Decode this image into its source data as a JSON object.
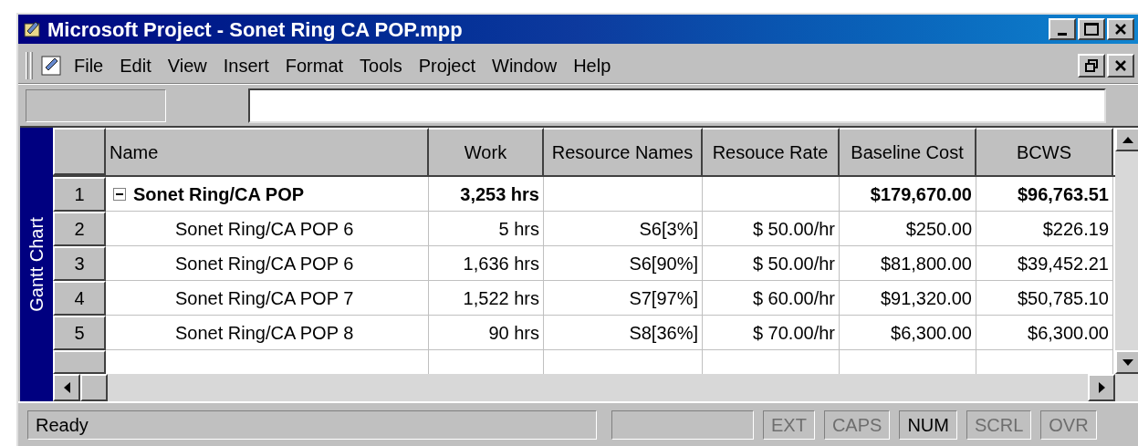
{
  "window": {
    "title": "Microsoft Project - Sonet Ring CA POP.mpp"
  },
  "menu": [
    "File",
    "Edit",
    "View",
    "Insert",
    "Format",
    "Tools",
    "Project",
    "Window",
    "Help"
  ],
  "view_bar": {
    "label": "Gantt Chart"
  },
  "table": {
    "columns": [
      "Name",
      "Work",
      "Resource Names",
      "Resouce Rate",
      "Baseline Cost",
      "BCWS"
    ],
    "rows": [
      {
        "id": "1",
        "kind": "summary",
        "expanded": true,
        "cells": [
          "Sonet Ring/CA POP",
          "3,253 hrs",
          "",
          "",
          "$179,670.00",
          "$96,763.51"
        ]
      },
      {
        "id": "2",
        "kind": "task",
        "cells": [
          "Sonet Ring/CA POP 6",
          "5 hrs",
          "S6[3%]",
          "$ 50.00/hr",
          "$250.00",
          "$226.19"
        ]
      },
      {
        "id": "3",
        "kind": "task",
        "cells": [
          "Sonet Ring/CA POP 6",
          "1,636 hrs",
          "S6[90%]",
          "$ 50.00/hr",
          "$81,800.00",
          "$39,452.21"
        ]
      },
      {
        "id": "4",
        "kind": "task",
        "cells": [
          "Sonet Ring/CA POP 7",
          "1,522 hrs",
          "S7[97%]",
          "$ 60.00/hr",
          "$91,320.00",
          "$50,785.10"
        ]
      },
      {
        "id": "5",
        "kind": "task",
        "cells": [
          "Sonet Ring/CA POP 8",
          "90 hrs",
          "S8[36%]",
          "$ 70.00/hr",
          "$6,300.00",
          "$6,300.00"
        ]
      }
    ]
  },
  "status_bar": {
    "message": "Ready",
    "indicators": [
      {
        "label": "EXT",
        "on": false
      },
      {
        "label": "CAPS",
        "on": false
      },
      {
        "label": "NUM",
        "on": true
      },
      {
        "label": "SCRL",
        "on": false
      },
      {
        "label": "OVR",
        "on": false
      }
    ]
  }
}
